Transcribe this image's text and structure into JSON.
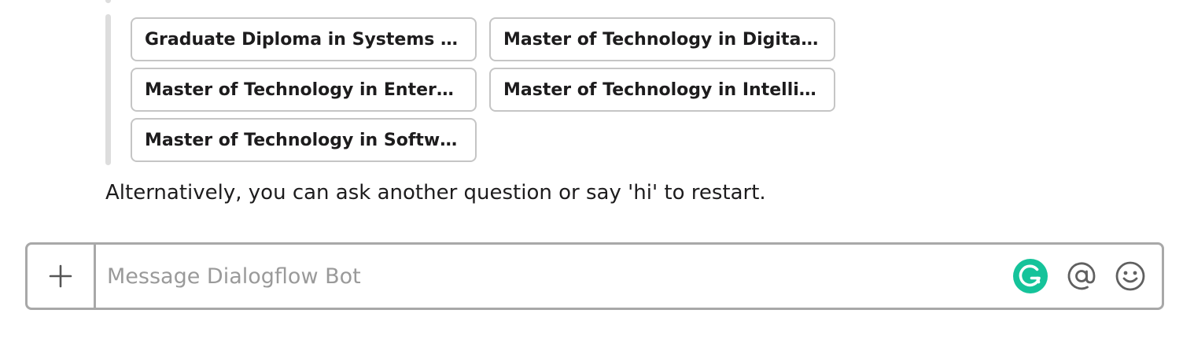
{
  "quick_replies": [
    {
      "label": "Graduate Diploma in Systems A..."
    },
    {
      "label": "Master of Technology in Digital ..."
    },
    {
      "label": "Master of Technology in Enterpr..."
    },
    {
      "label": "Master of Technology in Intellig..."
    },
    {
      "label": "Master of Technology in Softwar..."
    }
  ],
  "message": {
    "alternative_text": "Alternatively, you can ask another question or say 'hi' to restart."
  },
  "composer": {
    "placeholder": "Message Dialogflow Bot",
    "icons": {
      "add": "plus-icon",
      "grammarly": "grammarly-icon",
      "mention": "at-icon",
      "emoji": "emoji-icon"
    }
  },
  "colors": {
    "grammarly_green": "#15c39a",
    "border_gray": "#a8a8a8",
    "chip_border": "#c5c5c5",
    "attachment_bar": "#dddddd"
  }
}
